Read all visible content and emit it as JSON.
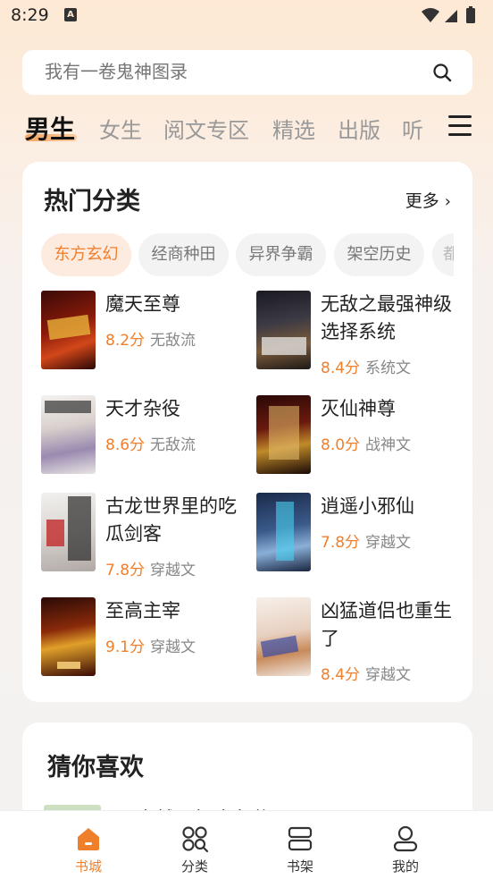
{
  "status": {
    "time": "8:29"
  },
  "search": {
    "placeholder": "我有一卷鬼神图录"
  },
  "tabs": [
    "男生",
    "女生",
    "阅文专区",
    "精选",
    "出版",
    "听"
  ],
  "hot": {
    "title": "热门分类",
    "more": "更多",
    "chips": [
      "东方玄幻",
      "经商种田",
      "异界争霸",
      "架空历史",
      "都"
    ],
    "books": [
      {
        "title": "魔天至尊",
        "score": "8.2分",
        "tag": "无敌流"
      },
      {
        "title": "无敌之最强神级选择系统",
        "score": "8.4分",
        "tag": "系统文"
      },
      {
        "title": "天才杂役",
        "score": "8.6分",
        "tag": "无敌流"
      },
      {
        "title": "灭仙神尊",
        "score": "8.0分",
        "tag": "战神文"
      },
      {
        "title": "古龙世界里的吃瓜剑客",
        "score": "7.8分",
        "tag": "穿越文"
      },
      {
        "title": "逍遥小邪仙",
        "score": "7.8分",
        "tag": "穿越文"
      },
      {
        "title": "至高主宰",
        "score": "9.1分",
        "tag": "穿越文"
      },
      {
        "title": "凶猛道侣也重生了",
        "score": "8.4分",
        "tag": "穿越文"
      }
    ]
  },
  "guess": {
    "title": "猜你喜欢",
    "peek": "穿越八年才出道"
  },
  "nav": [
    {
      "label": "书城",
      "icon": "home-icon"
    },
    {
      "label": "分类",
      "icon": "category-icon"
    },
    {
      "label": "书架",
      "icon": "bookshelf-icon"
    },
    {
      "label": "我的",
      "icon": "profile-icon"
    }
  ],
  "colors": {
    "accent": "#f07f2c",
    "chip_active_bg": "#fdebdf"
  }
}
